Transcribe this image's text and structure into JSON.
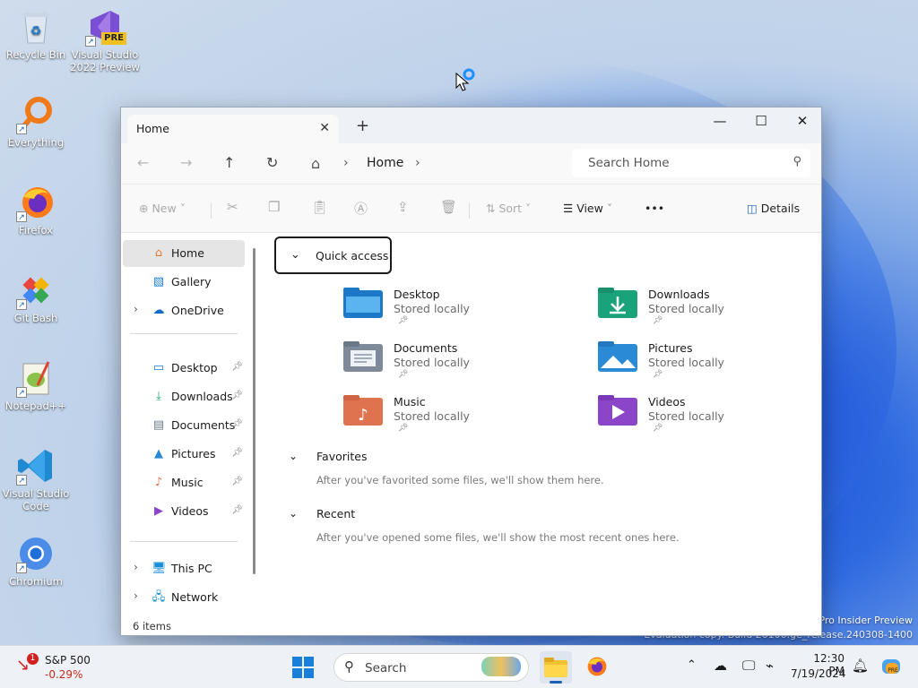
{
  "desktop": {
    "icons": [
      {
        "label": "Recycle Bin"
      },
      {
        "label": "Visual Studio 2022 Preview",
        "badge": "PRE"
      },
      {
        "label": "Everything"
      },
      {
        "label": "Firefox"
      },
      {
        "label": "Git Bash"
      },
      {
        "label": "Notepad++"
      },
      {
        "label": "Visual Studio Code"
      },
      {
        "label": "Chromium"
      }
    ],
    "watermark": {
      "line1": "Pro Insider Preview",
      "line2": "Evaluation copy. Build 26100.ge_release.240308-1400"
    }
  },
  "window": {
    "tab_title": "Home",
    "controls": {
      "minimize": "—",
      "maximize": "☐",
      "close": "✕"
    },
    "address": {
      "crumb": "Home"
    },
    "search": {
      "placeholder": "Search Home"
    },
    "toolbar": {
      "new": "New",
      "sort": "Sort",
      "view": "View",
      "more": "•••",
      "details": "Details"
    },
    "nav": {
      "top": [
        {
          "label": "Home",
          "selected": true
        },
        {
          "label": "Gallery"
        },
        {
          "label": "OneDrive"
        }
      ],
      "pinned": [
        {
          "label": "Desktop"
        },
        {
          "label": "Downloads"
        },
        {
          "label": "Documents"
        },
        {
          "label": "Pictures"
        },
        {
          "label": "Music"
        },
        {
          "label": "Videos"
        }
      ],
      "bottom": [
        {
          "label": "This PC"
        },
        {
          "label": "Network"
        }
      ]
    },
    "status": "6 items",
    "quick_access": {
      "title": "Quick access",
      "folders": [
        {
          "name": "Desktop",
          "sub": "Stored locally",
          "color": "#1e78c8"
        },
        {
          "name": "Downloads",
          "sub": "Stored locally",
          "color": "#1aa37a"
        },
        {
          "name": "Documents",
          "sub": "Stored locally",
          "color": "#7e8a9a"
        },
        {
          "name": "Pictures",
          "sub": "Stored locally",
          "color": "#2b8ad6"
        },
        {
          "name": "Music",
          "sub": "Stored locally",
          "color": "#e0734f"
        },
        {
          "name": "Videos",
          "sub": "Stored locally",
          "color": "#8a45c8"
        }
      ]
    },
    "favorites": {
      "title": "Favorites",
      "hint": "After you've favorited some files, we'll show them here."
    },
    "recent": {
      "title": "Recent",
      "hint": "After you've opened some files, we'll show the most recent ones here."
    }
  },
  "taskbar": {
    "stock": {
      "name": "S&P 500",
      "change": "-0.29%",
      "badge": "1"
    },
    "search": "Search",
    "time": "12:30 PM",
    "date": "7/19/2024"
  }
}
